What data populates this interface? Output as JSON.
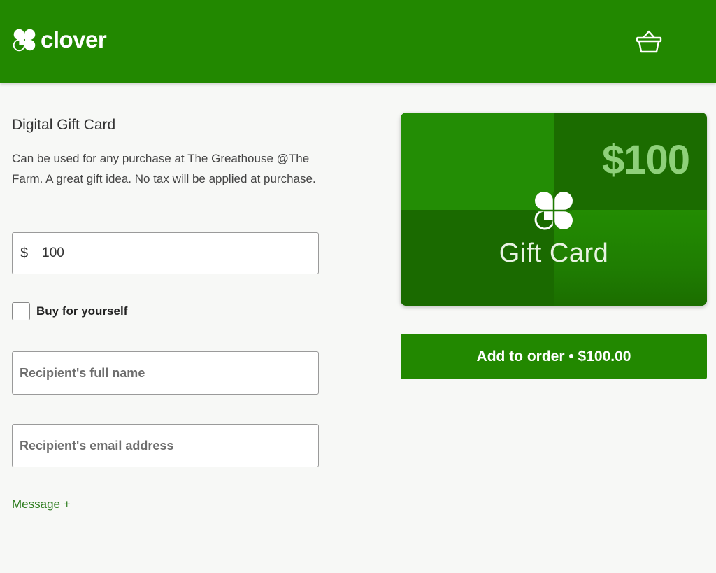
{
  "header": {
    "brand": "clover",
    "brand_color": "#228800",
    "cart_icon": "basket-icon"
  },
  "product": {
    "title": "Digital Gift Card",
    "description": "Can be used for any purchase at The Greathouse @The Farm. A great gift idea. No tax will be applied at purchase."
  },
  "form": {
    "currency_symbol": "$",
    "amount_value": "100",
    "buy_for_yourself_label": "Buy for yourself",
    "buy_for_yourself_checked": false,
    "recipient_name_placeholder": "Recipient's full name",
    "recipient_email_placeholder": "Recipient's email address",
    "message_link": "Message +"
  },
  "card": {
    "amount": "$100",
    "label": "Gift Card",
    "icon": "clover-icon"
  },
  "actions": {
    "add_to_order": "Add to order • $100.00"
  }
}
